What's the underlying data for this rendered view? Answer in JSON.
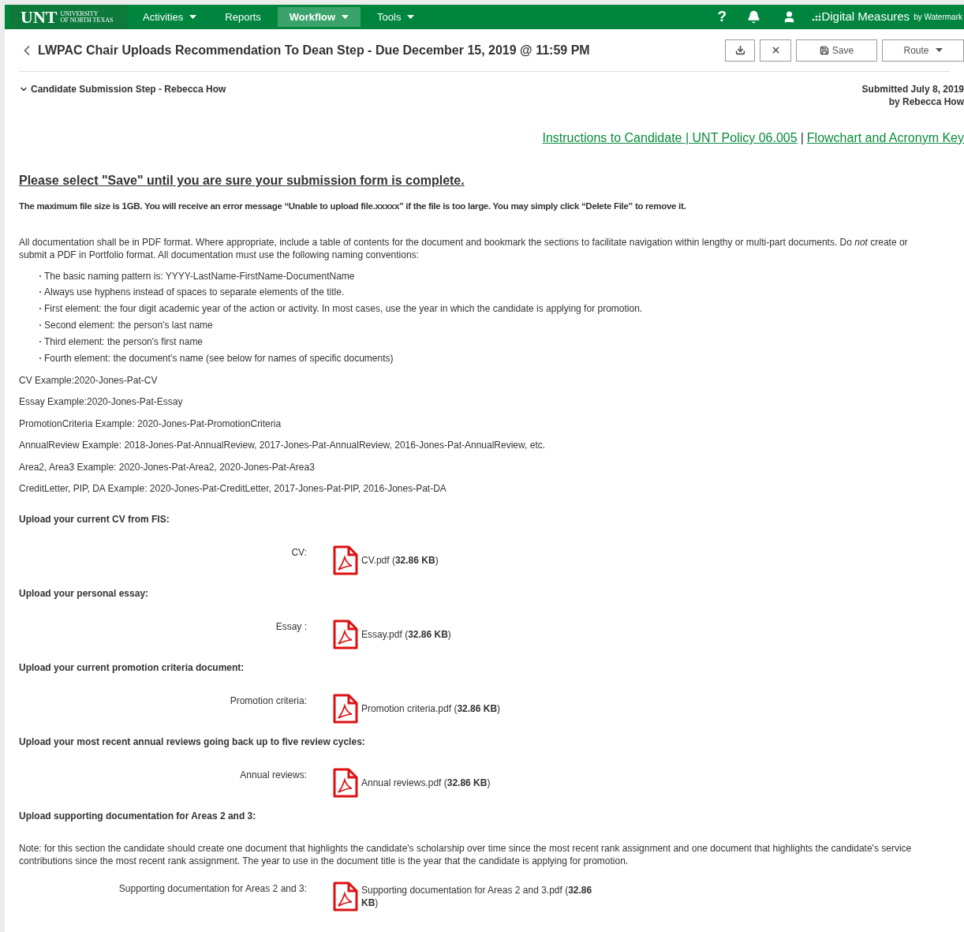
{
  "nav": {
    "logo": "UNT",
    "logo_sub": [
      "UNIVERSITY",
      "OF NORTH TEXAS"
    ],
    "menu": [
      {
        "label": "Activities",
        "dropdown": true,
        "selected": false
      },
      {
        "label": "Reports",
        "dropdown": false,
        "selected": false
      },
      {
        "label": "Workflow",
        "dropdown": true,
        "selected": true
      },
      {
        "label": "Tools",
        "dropdown": true,
        "selected": false
      }
    ],
    "help": "?",
    "brand": "Digital Measures",
    "brand_by": "by Watermark"
  },
  "header": {
    "title": "LWPAC Chair Uploads Recommendation To Dean Step - Due December 15, 2019 @ 11:59 PM",
    "buttons": [
      {
        "kind": "download"
      },
      {
        "kind": "close"
      },
      {
        "kind": "save",
        "label": "Save"
      },
      {
        "kind": "dropdown",
        "label": "Route"
      }
    ]
  },
  "step": {
    "label": "Candidate Submission Step - Rebecca How",
    "expanded": true,
    "submitted": [
      "Submitted July 8, 2019",
      "by Rebecca How"
    ]
  },
  "links": [
    "Instructions to Candidate | UNT Policy 06.005",
    "Flowchart and Acronym Key"
  ],
  "link_separator": "|",
  "heading": "Please select \"Save\" until you are sure your submission form is complete.",
  "file_size_note": "The maximum file size is 1GB.  You will receive an error message “Unable to upload file.xxxxx” if the file is too large. You may simply click “Delete File” to remove it.",
  "documentation_note": "All documentation shall be in PDF format. Where appropriate, include a table of contents for the document and bookmark the sections to facilitate navigation within lengthy or multi-part documents. Do *not* create or submit a PDF in Portfolio format. All documentation must use the following naming conventions:",
  "bullets": [
    "The basic naming pattern is: YYYY-LastName-FirstName-DocumentName",
    "Always use hyphens instead of spaces to separate elements of the title.",
    "First element: the four digit academic year of the action or activity. In most cases, use the year in which the candidate is applying for promotion.",
    "Second element: the person's last name",
    "Third element: the person's first name",
    "Fourth element: the document's name (see below for names of specific documents)"
  ],
  "examples": [
    "CV Example:2020-Jones-Pat-CV",
    "Essay Example:2020-Jones-Pat-Essay",
    "PromotionCriteria Example: 2020-Jones-Pat-PromotionCriteria",
    "AnnualReview Example: 2018-Jones-Pat-AnnualReview, 2017-Jones-Pat-AnnualReview, 2016-Jones-Pat-AnnualReview, etc.",
    "Area2, Area3 Example: 2020-Jones-Pat-Area2, 2020-Jones-Pat-Area3",
    "CreditLetter, PIP, DA Example:  2020-Jones-Pat-CreditLetter, 2017-Jones-Pat-PIP, 2016-Jones-Pat-DA"
  ],
  "sections": [
    {
      "kind": "heading",
      "text": "Upload your current CV from FIS:"
    },
    {
      "kind": "upload",
      "label": "CV:",
      "file": "CV.pdf (**32.86 KB**)"
    },
    {
      "kind": "heading",
      "text": "Upload your personal essay:"
    },
    {
      "kind": "upload",
      "label": "Essay :",
      "file": "Essay.pdf (**32.86 KB**)"
    },
    {
      "kind": "heading",
      "text": "Upload your current promotion criteria document:"
    },
    {
      "kind": "upload",
      "label": "Promotion criteria:",
      "file": "Promotion criteria.pdf (**32.86 KB**)"
    },
    {
      "kind": "heading",
      "text": "Upload your most recent annual reviews going back up to five review cycles:"
    },
    {
      "kind": "upload",
      "label": "Annual reviews:",
      "file": "Annual reviews.pdf (**32.86 KB**)"
    },
    {
      "kind": "heading",
      "text": "Upload supporting documentation for Areas 2 and 3:"
    },
    {
      "kind": "note",
      "text": "Note: for this section the candidate should create one document that highlights the candidate's scholarship over time since the most recent rank assignment and one document that highlights the candidate's service contributions since the most recent rank assignment. The year to use in the document title is the year that the candidate is applying for promotion."
    },
    {
      "kind": "upload",
      "label": "Supporting documentation for Areas 2 and 3:",
      "file": "Supporting documentation for Areas 2 and 3.pdf (**32.86 KB**)"
    }
  ]
}
